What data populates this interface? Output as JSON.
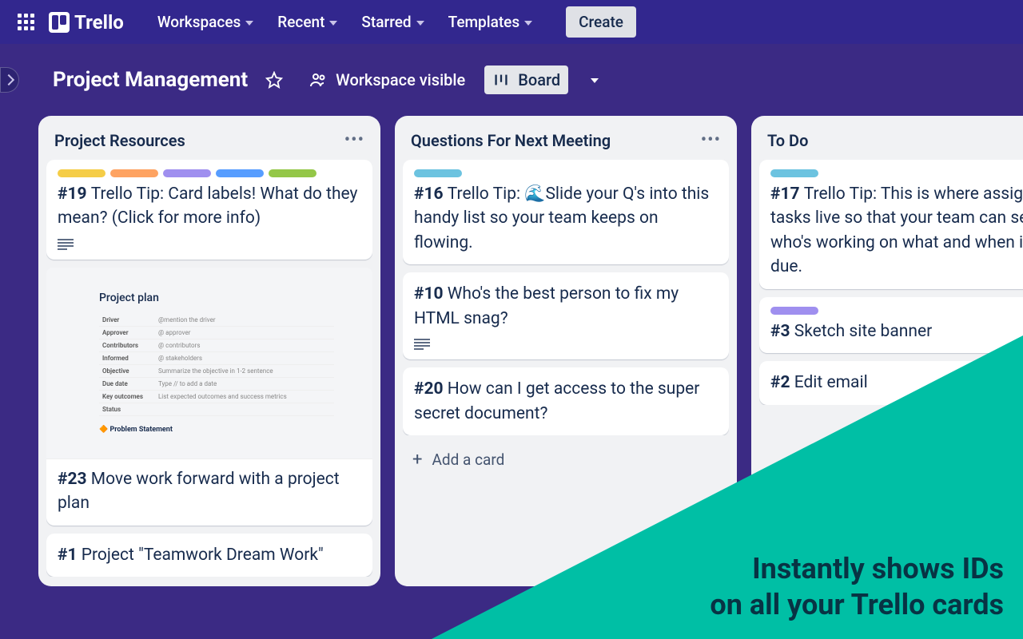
{
  "topbar": {
    "logo": "Trello",
    "nav": [
      "Workspaces",
      "Recent",
      "Starred",
      "Templates"
    ],
    "create": "Create"
  },
  "boardbar": {
    "title": "Project Management",
    "visibility": "Workspace visible",
    "view": "Board"
  },
  "lists": [
    {
      "title": "Project Resources",
      "cards": [
        {
          "id": "#19",
          "text": "Trello Tip: Card labels! What do they mean? (Click for more info)",
          "labels": [
            "yellow",
            "orange",
            "purple",
            "blue",
            "green"
          ],
          "desc": true
        },
        {
          "id": "#23",
          "text": "Move work forward with a project plan",
          "cover": true
        },
        {
          "id": "#1",
          "text": "Project \"Teamwork Dream Work\""
        }
      ]
    },
    {
      "title": "Questions For Next Meeting",
      "cards": [
        {
          "id": "#16",
          "text": "Trello Tip: 🌊Slide your Q's into this handy list so your team keeps on flowing.",
          "labels": [
            "teal"
          ]
        },
        {
          "id": "#10",
          "text": "Who's the best person to fix my HTML snag?",
          "desc": true
        },
        {
          "id": "#20",
          "text": "How can I get access to the super secret document?"
        }
      ],
      "addCard": "Add a card"
    },
    {
      "title": "To Do",
      "cards": [
        {
          "id": "#17",
          "text": "Trello Tip: This is where assigned tasks live so that your team can see who's working on what and when it's due.",
          "labels": [
            "teal"
          ]
        },
        {
          "id": "#3",
          "text": "Sketch site banner",
          "labels": [
            "purple2"
          ]
        },
        {
          "id": "#2",
          "text": "Edit email"
        }
      ]
    }
  ],
  "cover": {
    "title": "Project plan",
    "rows": [
      [
        "Driver",
        "@mention the driver"
      ],
      [
        "Approver",
        "@ approver"
      ],
      [
        "Contributors",
        "@ contributors"
      ],
      [
        "Informed",
        "@ stakeholders"
      ],
      [
        "Objective",
        "Summarize the objective in 1-2 sentence"
      ],
      [
        "Due date",
        "Type // to add a date"
      ],
      [
        "Key outcomes",
        "List expected outcomes and success metrics"
      ],
      [
        "Status",
        ""
      ]
    ],
    "ps": "Problem Statement"
  },
  "overlay": {
    "line1": "Instantly shows IDs",
    "line2": "on all your Trello cards"
  }
}
